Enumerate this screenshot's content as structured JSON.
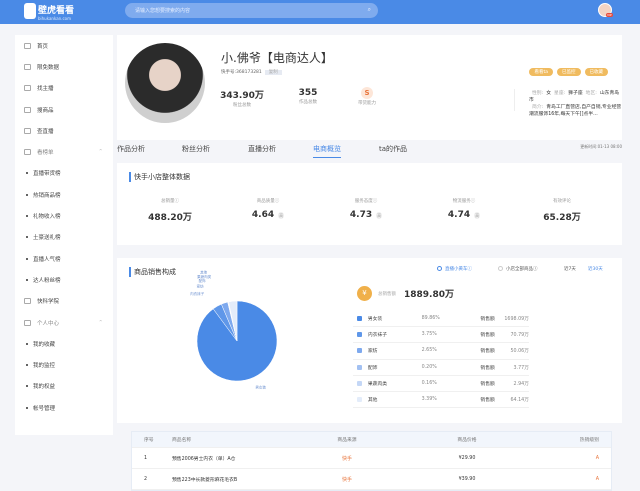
{
  "header": {
    "logo": "壁虎看看",
    "logo_sub": "bihukankan.com",
    "search_placeholder": "请输入您想要搜索的内容",
    "vip": "VIP"
  },
  "sidebar": {
    "items": [
      {
        "label": "首页",
        "type": "main"
      },
      {
        "label": "限免数据",
        "type": "main"
      },
      {
        "label": "找主播",
        "type": "main"
      },
      {
        "label": "搜商品",
        "type": "main"
      },
      {
        "label": "查直播",
        "type": "main"
      },
      {
        "label": "看榜单",
        "type": "group"
      },
      {
        "label": "直播带货榜",
        "type": "sub"
      },
      {
        "label": "热销商品榜",
        "type": "sub"
      },
      {
        "label": "礼物收入榜",
        "type": "sub"
      },
      {
        "label": "土豪送礼榜",
        "type": "sub"
      },
      {
        "label": "直播人气榜",
        "type": "sub"
      },
      {
        "label": "达人粉丝榜",
        "type": "sub"
      },
      {
        "label": "快科学院",
        "type": "main"
      },
      {
        "label": "个人中心",
        "type": "group"
      },
      {
        "label": "我的收藏",
        "type": "sub"
      },
      {
        "label": "我的监控",
        "type": "sub"
      },
      {
        "label": "我的权益",
        "type": "sub"
      },
      {
        "label": "帐号管理",
        "type": "sub"
      }
    ]
  },
  "profile": {
    "name": "小.佛爷【电商达人】",
    "kuaishou_id": "快手号:368173281",
    "copy": "复制",
    "fans": "343.90万",
    "fans_label": "粉丝总数",
    "works": "355",
    "works_label": "作品总数",
    "ability": "S",
    "ability_label": "带货能力",
    "gender_label": "性别:",
    "gender": "女",
    "constellation_label": "星座:",
    "constellation": "狮子座",
    "region_label": "地区:",
    "region": "山东青岛市",
    "intro_label": "简介:",
    "intro": "青岛工厂直营店,自产自销,专业经营潮流服饰16年,每天下午[]点半...",
    "buttons": [
      "看看ta",
      "已监控",
      "已收藏"
    ]
  },
  "tabs": {
    "items": [
      "作品分析",
      "粉丝分析",
      "直播分析",
      "电商概览",
      "ta的作品"
    ],
    "active": 3,
    "update_time": "更新时间:01-13 08:00"
  },
  "store": {
    "title": "快手小店整体数据",
    "metrics": [
      {
        "label": "总销量ⓘ",
        "value": "488.20万",
        "tag": ""
      },
      {
        "label": "商品质量ⓘ",
        "value": "4.64",
        "tag": "高"
      },
      {
        "label": "服务态度ⓘ",
        "value": "4.73",
        "tag": "高"
      },
      {
        "label": "物流服务ⓘ",
        "value": "4.74",
        "tag": "高"
      },
      {
        "label": "有效评论",
        "value": "65.28万",
        "tag": ""
      }
    ]
  },
  "sales": {
    "title": "商品销售构成",
    "radio1": "直播小黄车ⓘ",
    "radio2": "小店全部商品ⓘ",
    "range7": "近7天",
    "range30": "近30天",
    "total_label": "总销售额",
    "total": "1889.80万",
    "amount_label": "销售额"
  },
  "chart_data": {
    "type": "pie",
    "title": "商品销售构成",
    "slices": [
      {
        "name": "男女装",
        "percent": 89.86,
        "amount": "1698.09万",
        "color": "#4a8ae6"
      },
      {
        "name": "内衣袜子",
        "percent": 3.75,
        "amount": "70.79万",
        "color": "#5f97e9"
      },
      {
        "name": "家纺",
        "percent": 2.65,
        "amount": "50.06万",
        "color": "#7ea9ee"
      },
      {
        "name": "配饰",
        "percent": 0.2,
        "amount": "3.77万",
        "color": "#a3c1f2"
      },
      {
        "name": "果蔬肉类",
        "percent": 0.16,
        "amount": "2.94万",
        "color": "#c4d7f6"
      },
      {
        "name": "其他",
        "percent": 3.39,
        "amount": "64.14万",
        "color": "#e3ecfa"
      }
    ]
  },
  "table": {
    "headers": [
      "序号",
      "商品名称",
      "商品来源",
      "商品价格",
      "热销级别"
    ],
    "rows": [
      {
        "idx": "1",
        "name": "预售2006男士内衣（单）A仓",
        "source": "快手",
        "price": "¥29.90",
        "level": "A"
      },
      {
        "idx": "2",
        "name": "预售223中长款菱形麻花毛衣B",
        "source": "快手",
        "price": "¥39.90",
        "level": "A"
      }
    ]
  }
}
